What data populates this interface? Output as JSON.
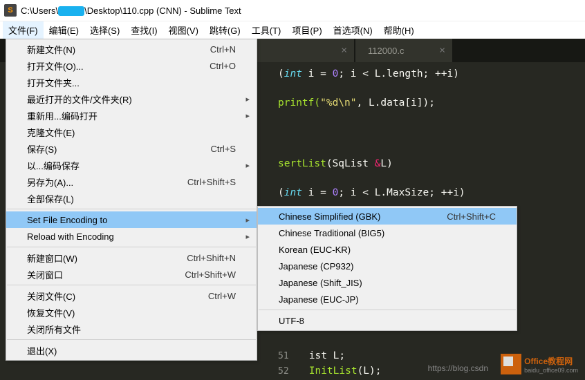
{
  "title": {
    "prefix": "C:\\Users\\",
    "suffix": "\\Desktop\\110.cpp (CNN) - Sublime Text"
  },
  "menubar": [
    "文件(F)",
    "编辑(E)",
    "选择(S)",
    "查找(I)",
    "视图(V)",
    "跳转(G)",
    "工具(T)",
    "项目(P)",
    "首选项(N)",
    "帮助(H)"
  ],
  "tabs": [
    {
      "label": ""
    },
    {
      "label": "112000.c"
    }
  ],
  "file_menu": [
    {
      "label": "新建文件(N)",
      "shortcut": "Ctrl+N"
    },
    {
      "label": "打开文件(O)...",
      "shortcut": "Ctrl+O"
    },
    {
      "label": "打开文件夹..."
    },
    {
      "label": "最近打开的文件/文件夹(R)",
      "sub": true
    },
    {
      "label": "重新用...编码打开",
      "sub": true
    },
    {
      "label": "克隆文件(E)"
    },
    {
      "label": "保存(S)",
      "shortcut": "Ctrl+S"
    },
    {
      "label": "以...编码保存",
      "sub": true
    },
    {
      "label": "另存为(A)...",
      "shortcut": "Ctrl+Shift+S"
    },
    {
      "label": "全部保存(L)"
    },
    {
      "sep": true
    },
    {
      "label": "Set File Encoding to",
      "sub": true,
      "hl": true
    },
    {
      "label": "Reload with Encoding",
      "sub": true
    },
    {
      "sep": true
    },
    {
      "label": "新建窗口(W)",
      "shortcut": "Ctrl+Shift+N"
    },
    {
      "label": "关闭窗口",
      "shortcut": "Ctrl+Shift+W"
    },
    {
      "sep": true
    },
    {
      "label": "关闭文件(C)",
      "shortcut": "Ctrl+W"
    },
    {
      "label": "恢复文件(V)"
    },
    {
      "label": "关闭所有文件"
    },
    {
      "sep": true
    },
    {
      "label": "退出(X)"
    }
  ],
  "encoding_menu": [
    {
      "label": "Chinese Simplified (GBK)",
      "shortcut": "Ctrl+Shift+C",
      "hl": true
    },
    {
      "label": "Chinese Traditional (BIG5)"
    },
    {
      "label": "Korean (EUC-KR)"
    },
    {
      "label": "Japanese (CP932)"
    },
    {
      "label": "Japanese (Shift_JIS)"
    },
    {
      "label": "Japanese (EUC-JP)"
    },
    {
      "sep": true
    },
    {
      "label": "UTF-8"
    }
  ],
  "code": {
    "line_for": "(int i = 0; i < L.length; ++i)",
    "line_printf_a": "printf(",
    "line_printf_str": "\"%d\\n\"",
    "line_printf_b": ", L.data[i]);",
    "line_fn": "sertList(SqList &L)",
    "line_for2_a": "(",
    "line_for2_type": "int",
    "line_for2_b": " i = ",
    "line_for2_num": "0",
    "line_for2_c": "; i < L.MaxSize; ++i)",
    "bottom_a": "ist L;",
    "bottom_b": "InitList(L);",
    "gutter": [
      "51",
      "52"
    ]
  },
  "watermark": {
    "url": "https://blog.csdn",
    "brand": "Office教程网",
    "sub": "baidu_office09.com"
  }
}
